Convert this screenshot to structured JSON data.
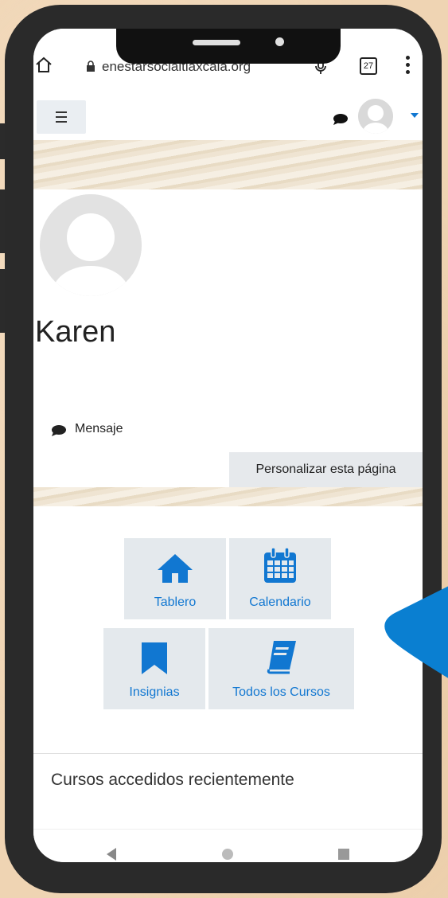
{
  "browser": {
    "url": "enestarsocialtlaxcala.org",
    "tab_count": "27"
  },
  "profile": {
    "name": "Karen",
    "message_label": "Mensaje",
    "customize_label": "Personalizar esta página"
  },
  "quick_links": [
    {
      "label": "Tablero",
      "icon": "home-icon"
    },
    {
      "label": "Calendario",
      "icon": "calendar-icon"
    },
    {
      "label": "Insignias",
      "icon": "bookmark-icon"
    },
    {
      "label": "Todos los Cursos",
      "icon": "book-icon"
    }
  ],
  "recent": {
    "title": "Cursos accedidos recientemente"
  },
  "colors": {
    "accent": "#1177d1",
    "tile_bg": "#e4e9ed",
    "pointer": "#0a7fd1"
  }
}
